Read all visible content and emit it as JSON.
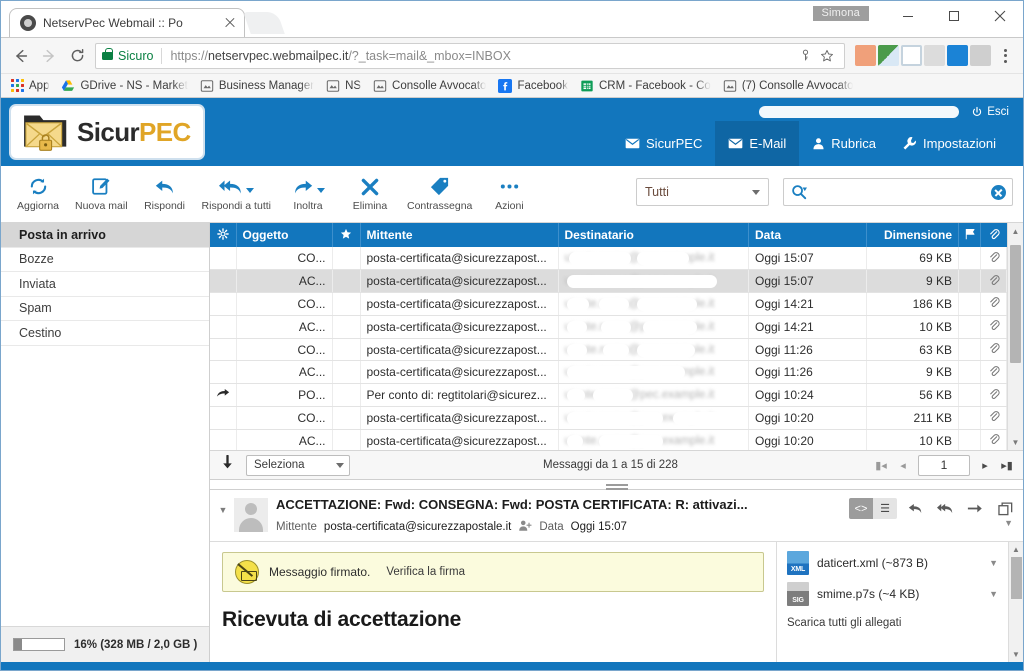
{
  "browser": {
    "tab": {
      "title": "NetservPec Webmail :: Po",
      "favicon": "globe-icon",
      "close": "×"
    },
    "window_user": "Simona",
    "controls": {
      "minimize": "minimize-icon",
      "maximize": "maximize-icon",
      "close": "close-icon"
    },
    "nav": {
      "back": "←",
      "forward": "→",
      "reload": "↻"
    },
    "omnibox": {
      "secure_label": "Sicuro",
      "url_scheme": "https://",
      "url_main": "netservpec.webmailpec.it",
      "url_query": "/?_task=mail&_mbox=INBOX",
      "key_icon": "key-icon",
      "star_icon": "star-icon"
    },
    "extensions": [
      {
        "name": "robot-extension-icon",
        "color": "#f0a07a"
      },
      {
        "name": "notes-extension-icon",
        "color": "#4b9b4b"
      },
      {
        "name": "book-extension-icon",
        "color": "#b9c9d8"
      },
      {
        "name": "c-extension-icon",
        "color": "#cccccc"
      },
      {
        "name": "trello-extension-icon",
        "color": "#1b83d6"
      },
      {
        "name": "pdf-extension-icon",
        "color": "#bdbdbd"
      }
    ],
    "menu": "chrome-menu-icon",
    "bookmarks": [
      {
        "label": "App",
        "icon": "apps-grid-icon"
      },
      {
        "label": "GDrive - NS - Market",
        "icon": "drive-icon"
      },
      {
        "label": "Business Manager",
        "icon": "page-icon"
      },
      {
        "label": "NS",
        "icon": "page-icon"
      },
      {
        "label": "Consolle Avvocato",
        "icon": "page-icon"
      },
      {
        "label": "Facebook",
        "icon": "facebook-icon"
      },
      {
        "label": "CRM - Facebook - Co",
        "icon": "sheets-icon"
      },
      {
        "label": "(7) Consolle Avvocato",
        "icon": "page-icon"
      }
    ]
  },
  "app": {
    "brand": {
      "name_part1": "Sicur",
      "name_part2": "PEC",
      "logo_icon": "folder-envelope-lock-icon"
    },
    "account_redacted": true,
    "logout": {
      "label": "Esci",
      "icon": "power-icon"
    },
    "nav": [
      {
        "label": "SicurPEC",
        "icon": "envelope-icon",
        "active": false
      },
      {
        "label": "E-Mail",
        "icon": "envelope-icon",
        "active": true
      },
      {
        "label": "Rubrica",
        "icon": "person-icon",
        "active": false
      },
      {
        "label": "Impostazioni",
        "icon": "wrench-icon",
        "active": false
      }
    ],
    "colors": {
      "brand_blue": "#1276bd",
      "active_blue": "#0f66a4",
      "accent_gold": "#e0a526"
    }
  },
  "toolbar": {
    "buttons": [
      {
        "label": "Aggiorna",
        "icon": "refresh-icon",
        "caret": false
      },
      {
        "label": "Nuova mail",
        "icon": "compose-icon",
        "caret": false
      },
      {
        "label": "Rispondi",
        "icon": "reply-icon",
        "caret": false
      },
      {
        "label": "Rispondi a tutti",
        "icon": "reply-all-icon",
        "caret": true
      },
      {
        "label": "Inoltra",
        "icon": "forward-icon",
        "caret": true
      },
      {
        "label": "Elimina",
        "icon": "delete-x-icon",
        "caret": false
      },
      {
        "label": "Contrassegna",
        "icon": "tag-icon",
        "caret": false
      },
      {
        "label": "Azioni",
        "icon": "ellipsis-icon",
        "caret": false
      }
    ],
    "scope": {
      "value": "Tutti",
      "caret": "chevron-down-icon"
    },
    "search": {
      "value": "",
      "placeholder": "",
      "icon": "search-icon",
      "clear_icon": "clear-circle-icon"
    }
  },
  "folders": {
    "items": [
      {
        "label": "Posta in arrivo",
        "active": true
      },
      {
        "label": "Bozze",
        "active": false
      },
      {
        "label": "Inviata",
        "active": false
      },
      {
        "label": "Spam",
        "active": false
      },
      {
        "label": "Cestino",
        "active": false
      }
    ],
    "quota": {
      "text": "16% (328 MB / 2,0 GB )",
      "percent": 16
    }
  },
  "maillist": {
    "columns": {
      "gear": "gear-icon",
      "subject": "Oggetto",
      "star": "star-icon",
      "sender": "Mittente",
      "recipient": "Destinatario",
      "date": "Data",
      "size": "Dimensione",
      "flag": "flag-icon",
      "clip": "paperclip-icon"
    },
    "rows": [
      {
        "fwd": false,
        "subject": "CO...",
        "sender": "posta-certificata@sicurezzapost...",
        "recipient": "",
        "date": "Oggi 15:07",
        "size": "69 KB",
        "clip": true,
        "selected": false
      },
      {
        "fwd": false,
        "subject": "AC...",
        "sender": "posta-certificata@sicurezzapost...",
        "recipient": "",
        "date": "Oggi 15:07",
        "size": "9 KB",
        "clip": true,
        "selected": true
      },
      {
        "fwd": false,
        "subject": "CO...",
        "sender": "posta-certificata@sicurezzapost...",
        "recipient": "",
        "date": "Oggi 14:21",
        "size": "186 KB",
        "clip": true,
        "selected": false
      },
      {
        "fwd": false,
        "subject": "AC...",
        "sender": "posta-certificata@sicurezzapost...",
        "recipient": "",
        "date": "Oggi 14:21",
        "size": "10 KB",
        "clip": true,
        "selected": false
      },
      {
        "fwd": false,
        "subject": "CO...",
        "sender": "posta-certificata@sicurezzapost...",
        "recipient": "",
        "date": "Oggi 11:26",
        "size": "63 KB",
        "clip": true,
        "selected": false
      },
      {
        "fwd": false,
        "subject": "AC...",
        "sender": "posta-certificata@sicurezzapost...",
        "recipient": "",
        "date": "Oggi 11:26",
        "size": "9 KB",
        "clip": true,
        "selected": false
      },
      {
        "fwd": true,
        "subject": "PO...",
        "sender": "Per conto di: regtitolari@sicurez...",
        "recipient": "",
        "date": "Oggi 10:24",
        "size": "56 KB",
        "clip": true,
        "selected": false
      },
      {
        "fwd": false,
        "subject": "CO...",
        "sender": "posta-certificata@sicurezzapost...",
        "recipient": "",
        "date": "Oggi 10:20",
        "size": "211 KB",
        "clip": true,
        "selected": false
      },
      {
        "fwd": false,
        "subject": "AC...",
        "sender": "posta-certificata@sicurezzapost...",
        "recipient": "",
        "date": "Oggi 10:20",
        "size": "10 KB",
        "clip": true,
        "selected": false
      }
    ],
    "footer": {
      "download_icon": "download-arrow-icon",
      "select_label": "Seleziona",
      "count_text": "Messaggi da 1 a 15 di 228",
      "page_value": "1",
      "first_icon": "first-page-icon",
      "prev_icon": "prev-page-icon",
      "next_icon": "next-page-icon",
      "last_icon": "last-page-icon"
    }
  },
  "preview": {
    "subject": "ACCETTAZIONE: Fwd: CONSEGNA: Fwd: POSTA CERTIFICATA: R: attivazi...",
    "sender_label": "Mittente",
    "sender_value": "posta-certificata@sicurezzapostale.it",
    "date_label": "Data",
    "date_value": "Oggi 15:07",
    "add_contact_icon": "add-contact-icon",
    "toggles": [
      {
        "name": "source-view-icon",
        "glyph": "<>",
        "on": true
      },
      {
        "name": "list-view-icon",
        "glyph": "☰",
        "on": false
      }
    ],
    "actions": [
      {
        "name": "reply-icon",
        "glyph": "↩"
      },
      {
        "name": "reply-all-icon",
        "glyph": "↞"
      },
      {
        "name": "forward-icon",
        "glyph": "→"
      },
      {
        "name": "open-window-icon",
        "glyph": "❐"
      }
    ],
    "signed": {
      "icon": "signature-disabled-icon",
      "text": "Messaggio firmato.",
      "link": "Verifica la firma"
    },
    "body_title": "Ricevuta di accettazione",
    "attachments": [
      {
        "name": "daticert.xml (~873 B)",
        "type": "XML"
      },
      {
        "name": "smime.p7s (~4 KB)",
        "type": "SIG"
      }
    ],
    "download_all": "Scarica tutti gli allegati"
  }
}
